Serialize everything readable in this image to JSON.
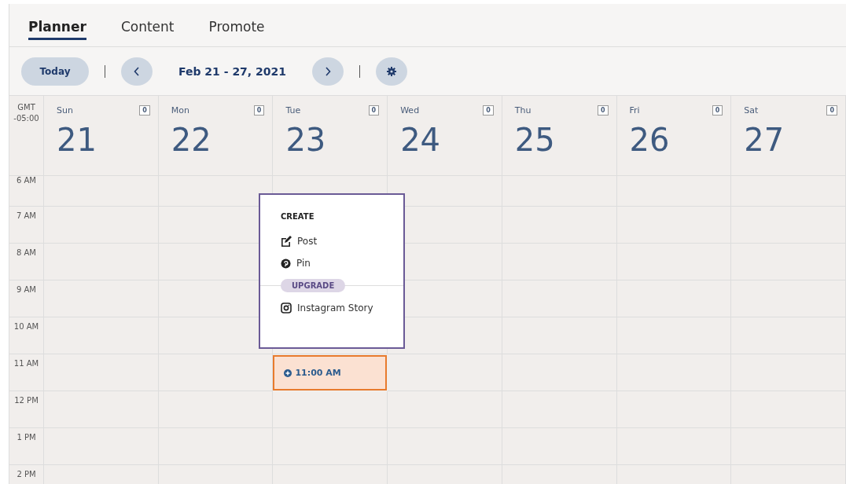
{
  "tabs": [
    {
      "label": "Planner",
      "selected": true
    },
    {
      "label": "Content",
      "selected": false
    },
    {
      "label": "Promote",
      "selected": false
    }
  ],
  "toolbar": {
    "today": "Today",
    "range": "Feb 21 - 27, 2021"
  },
  "timezone": "GMT -05:00",
  "days": [
    {
      "name": "Sun",
      "date": "21",
      "count": "0"
    },
    {
      "name": "Mon",
      "date": "22",
      "count": "0"
    },
    {
      "name": "Tue",
      "date": "23",
      "count": "0"
    },
    {
      "name": "Wed",
      "date": "24",
      "count": "0"
    },
    {
      "name": "Thu",
      "date": "25",
      "count": "0"
    },
    {
      "name": "Fri",
      "date": "26",
      "count": "0"
    },
    {
      "name": "Sat",
      "date": "27",
      "count": "0"
    }
  ],
  "hours": [
    "6 AM",
    "7 AM",
    "8 AM",
    "9 AM",
    "10 AM",
    "11 AM",
    "12 PM",
    "1 PM",
    "2 PM"
  ],
  "hover_slot": {
    "label": "11:00 AM"
  },
  "menu": {
    "heading": "CREATE",
    "items": [
      {
        "kind": "post",
        "label": "Post"
      },
      {
        "kind": "pin",
        "label": "Pin"
      }
    ],
    "badge": "UPGRADE",
    "locked_items": [
      {
        "kind": "instagram",
        "label": "Instagram Story"
      }
    ]
  }
}
